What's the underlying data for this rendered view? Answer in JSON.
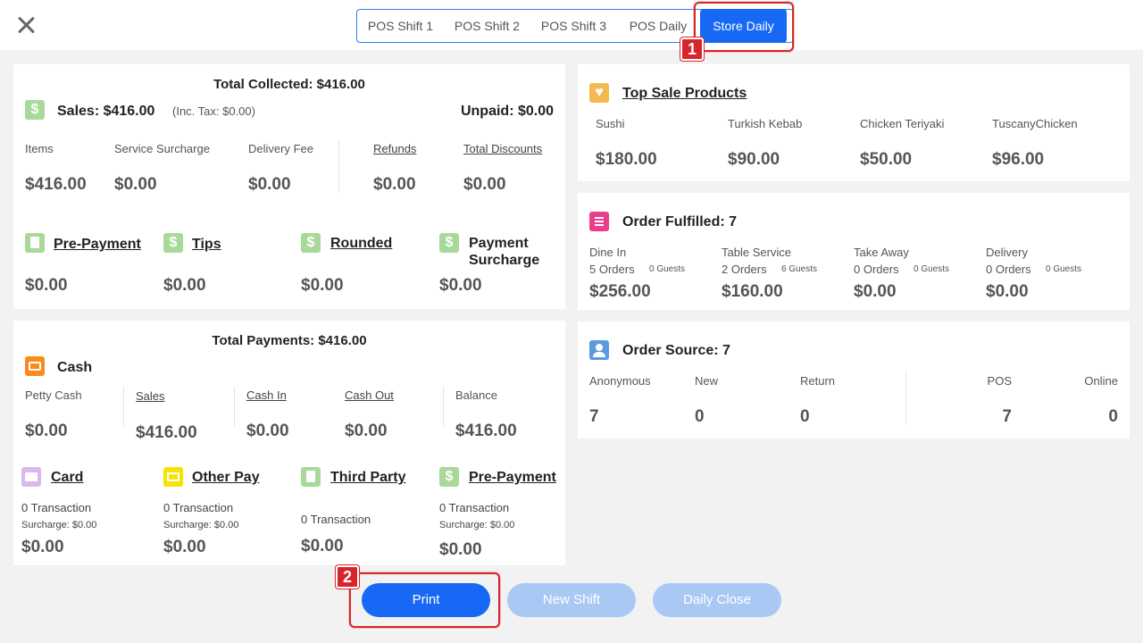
{
  "tabs": [
    "POS Shift 1",
    "POS Shift 2",
    "POS Shift 3",
    "POS Daily",
    "Store Daily"
  ],
  "active_tab": "Store Daily",
  "markers": {
    "m1": "1",
    "m2": "2"
  },
  "collected": {
    "title": "Total Collected: $416.00",
    "sales": "Sales: $416.00",
    "inc_tax": "(Inc. Tax: $0.00)",
    "unpaid": "Unpaid: $0.00",
    "items": [
      {
        "label": "Items",
        "value": "$416.00"
      },
      {
        "label": "Service Surcharge",
        "value": "$0.00"
      },
      {
        "label": "Delivery Fee",
        "value": "$0.00"
      },
      {
        "label": "Refunds",
        "value": "$0.00"
      },
      {
        "label": "Total Discounts",
        "value": "$0.00"
      }
    ],
    "extras": [
      {
        "label": "Pre-Payment",
        "value": "$0.00"
      },
      {
        "label": "Tips",
        "value": "$0.00"
      },
      {
        "label": "Rounded",
        "value": "$0.00"
      },
      {
        "label": "Payment",
        "label2": "Surcharge",
        "value": "$0.00"
      }
    ]
  },
  "payments": {
    "title": "Total Payments: $416.00",
    "cash": "Cash",
    "cash_items": [
      {
        "label": "Petty Cash",
        "value": "$0.00"
      },
      {
        "label": "Sales",
        "value": "$416.00"
      },
      {
        "label": "Cash In",
        "value": "$0.00"
      },
      {
        "label": "Cash Out",
        "value": "$0.00"
      },
      {
        "label": "Balance",
        "value": "$416.00"
      }
    ],
    "methods": [
      {
        "label": "Card",
        "txn": "0 Transaction",
        "surcharge": "Surcharge: $0.00",
        "value": "$0.00"
      },
      {
        "label": "Other Pay",
        "txn": "0 Transaction",
        "surcharge": "Surcharge: $0.00",
        "value": "$0.00"
      },
      {
        "label": "Third Party",
        "txn": "0 Transaction",
        "value": "$0.00"
      },
      {
        "label": "Pre-Payment",
        "txn": "0 Transaction",
        "surcharge": "Surcharge: $0.00",
        "value": "$0.00"
      }
    ]
  },
  "top_products": {
    "title": "Top Sale Products",
    "items": [
      {
        "name": "Sushi",
        "value": "$180.00"
      },
      {
        "name": "Turkish Kebab",
        "value": "$90.00"
      },
      {
        "name": "Chicken Teriyaki",
        "value": "$50.00"
      },
      {
        "name": "TuscanyChicken",
        "value": "$96.00"
      }
    ]
  },
  "fulfilled": {
    "title": "Order Fulfilled: 7",
    "items": [
      {
        "label": "Dine In",
        "orders": "5 Orders",
        "guests": "0 Guests",
        "value": "$256.00"
      },
      {
        "label": "Table Service",
        "orders": "2 Orders",
        "guests": "6 Guests",
        "value": "$160.00"
      },
      {
        "label": "Take Away",
        "orders": "0 Orders",
        "guests": "0 Guests",
        "value": "$0.00"
      },
      {
        "label": "Delivery",
        "orders": "0 Orders",
        "guests": "0 Guests",
        "value": "$0.00"
      }
    ]
  },
  "source": {
    "title": "Order Source: 7",
    "items": [
      {
        "label": "Anonymous",
        "value": "7"
      },
      {
        "label": "New",
        "value": "0"
      },
      {
        "label": "Return",
        "value": "0"
      },
      {
        "label": "POS",
        "value": "7"
      },
      {
        "label": "Online",
        "value": "0"
      }
    ]
  },
  "buttons": {
    "print": "Print",
    "new_shift": "New Shift",
    "daily_close": "Daily Close"
  },
  "icons": {
    "close": "close-icon",
    "dollar": "dollar-icon",
    "doc": "document-icon",
    "wallet": "wallet-icon",
    "card": "credit-card-icon",
    "heart": "heart-icon",
    "list": "list-icon",
    "users": "users-icon"
  },
  "colors": {
    "primary": "#1769f5",
    "disabled": "#a9c9f4",
    "marker": "#d7262b",
    "green_icon": "#a8d99a"
  }
}
